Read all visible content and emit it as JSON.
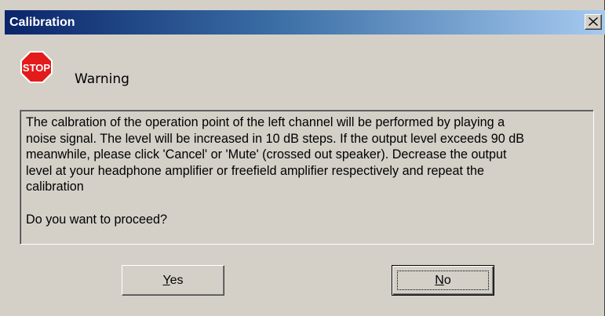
{
  "window": {
    "title": "Calibration",
    "close_glyph": "✕"
  },
  "icon": {
    "name": "stop-icon",
    "text": "STOP",
    "color": "#e31b1b"
  },
  "heading": "Warning",
  "message": {
    "body": "The calbration of the operation point of the left channel will be performed by playing  a\nnoise signal. The level will be increased in 10 dB steps. If the output level exceeds 90 dB\nmeanwhile, please click 'Cancel' or 'Mute' (crossed out speaker). Decrease the output\nlevel at your headphone amplifier or freefield amplifier respectively and repeat the\ncalibration",
    "question": "Do you want to proceed?"
  },
  "buttons": {
    "yes": {
      "accel": "Y",
      "rest": "es"
    },
    "no": {
      "accel": "N",
      "rest": "o"
    }
  }
}
